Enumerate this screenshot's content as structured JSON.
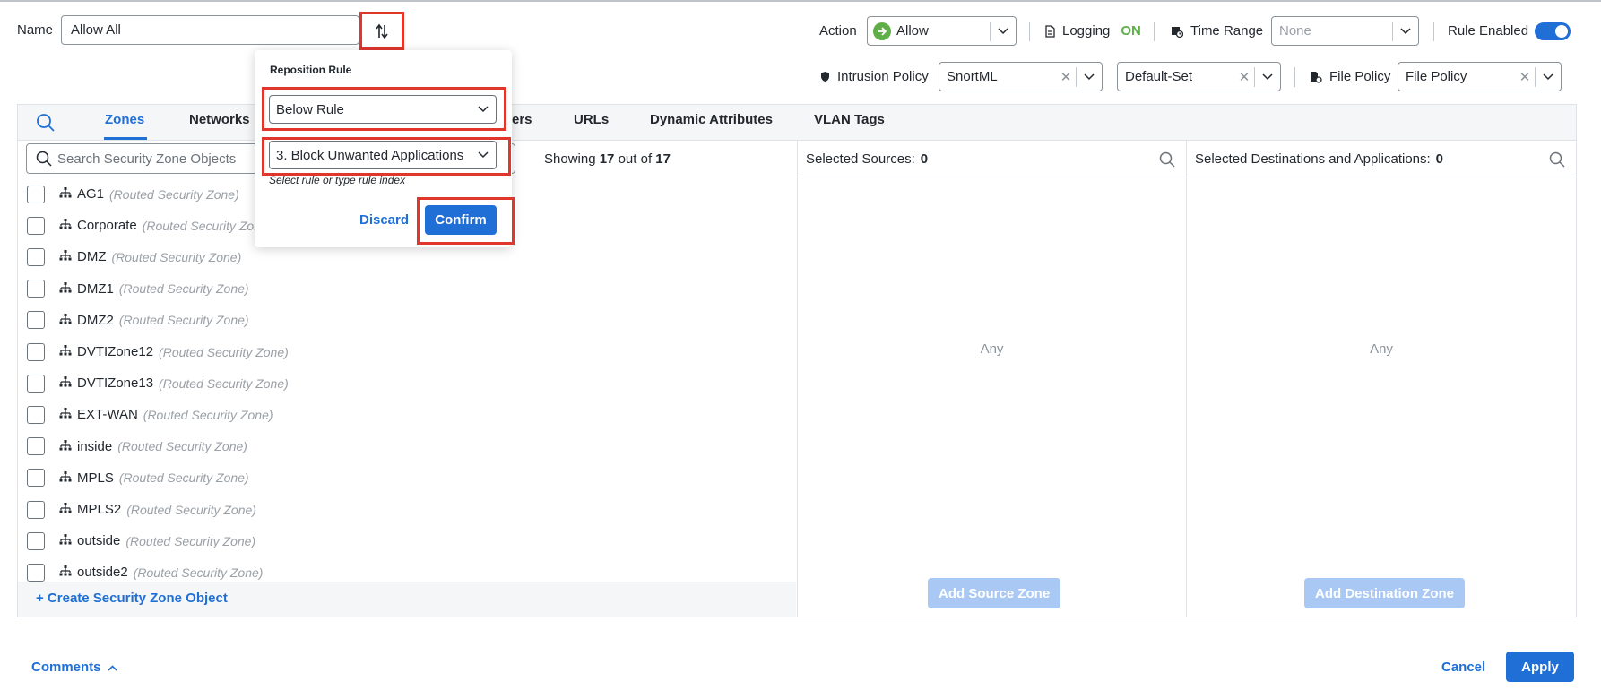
{
  "header": {
    "name_label": "Name",
    "name_value": "Allow All",
    "action_label": "Action",
    "action_value": "Allow",
    "logging_label": "Logging",
    "logging_state": "ON",
    "time_range_label": "Time Range",
    "time_range_placeholder": "None",
    "rule_enabled_label": "Rule Enabled",
    "rule_enabled": true,
    "intrusion_policy_label": "Intrusion Policy",
    "intrusion_policy_value": "SnortML",
    "variable_set_value": "Default-Set",
    "file_policy_label": "File Policy",
    "file_policy_value": "File Policy"
  },
  "tabs": [
    {
      "label": "Zones",
      "active": true
    },
    {
      "label": "Networks"
    },
    {
      "label": "ers"
    },
    {
      "label": "URLs"
    },
    {
      "label": "Dynamic Attributes"
    },
    {
      "label": "VLAN Tags"
    }
  ],
  "zones": {
    "search_placeholder": "Search Security Zone Objects",
    "showing_prefix": "Showing",
    "showing_count": "17",
    "showing_mid": "out of",
    "showing_total": "17",
    "items": [
      {
        "name": "AG1",
        "type": "(Routed Security Zone)"
      },
      {
        "name": "Corporate",
        "type": "(Routed Security Zone)"
      },
      {
        "name": "DMZ",
        "type": "(Routed Security Zone)"
      },
      {
        "name": "DMZ1",
        "type": "(Routed Security Zone)"
      },
      {
        "name": "DMZ2",
        "type": "(Routed Security Zone)"
      },
      {
        "name": "DVTIZone12",
        "type": "(Routed Security Zone)"
      },
      {
        "name": "DVTIZone13",
        "type": "(Routed Security Zone)"
      },
      {
        "name": "EXT-WAN",
        "type": "(Routed Security Zone)"
      },
      {
        "name": "inside",
        "type": "(Routed Security Zone)"
      },
      {
        "name": "MPLS",
        "type": "(Routed Security Zone)"
      },
      {
        "name": "MPLS2",
        "type": "(Routed Security Zone)"
      },
      {
        "name": "outside",
        "type": "(Routed Security Zone)"
      },
      {
        "name": "outside2",
        "type": "(Routed Security Zone)"
      }
    ],
    "create_link": "+ Create Security Zone Object"
  },
  "sources": {
    "title": "Selected Sources:",
    "count": "0",
    "empty_text": "Any",
    "add_button": "Add Source Zone"
  },
  "destinations": {
    "title": "Selected Destinations and Applications:",
    "count": "0",
    "empty_text": "Any",
    "add_button": "Add Destination Zone"
  },
  "reposition": {
    "title": "Reposition Rule",
    "position_value": "Below Rule",
    "rule_value": "3. Block Unwanted Applications",
    "hint": "Select rule or type rule index",
    "discard_label": "Discard",
    "confirm_label": "Confirm"
  },
  "footer": {
    "comments_label": "Comments",
    "cancel_label": "Cancel",
    "apply_label": "Apply"
  },
  "colors": {
    "accent": "#1f6fd6",
    "success": "#5fae48",
    "highlight": "#e0362c"
  }
}
